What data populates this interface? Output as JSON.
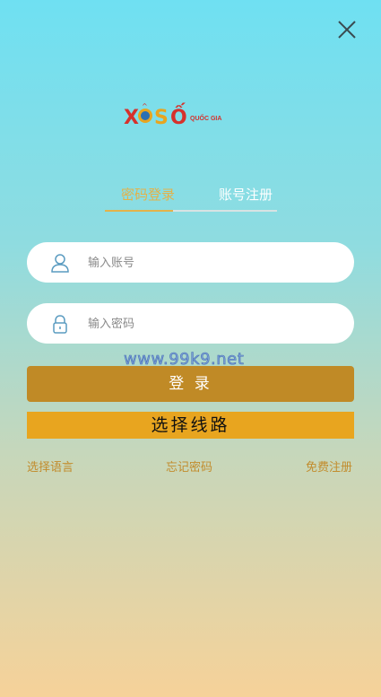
{
  "logo": {
    "brand_text": "XỔSỐ",
    "sub_text": "QUỐC GIA"
  },
  "tabs": [
    {
      "label": "密码登录",
      "active": true
    },
    {
      "label": "账号注册",
      "active": false
    }
  ],
  "form": {
    "account_placeholder": "输入账号",
    "password_placeholder": "输入密码"
  },
  "watermark": "www.99k9.net",
  "buttons": {
    "login": "登 录",
    "select_route": "选择线路"
  },
  "links": {
    "language": "选择语言",
    "forgot": "忘记密码",
    "register": "免费注册"
  },
  "colors": {
    "accent": "#e3b24a",
    "login_bg": "#c08a26",
    "route_bg": "#e8a51f",
    "link": "#c28c2d",
    "icon": "#5a9bc0"
  },
  "icons": {
    "close": "close-icon",
    "user": "user-icon",
    "lock": "lock-icon"
  }
}
